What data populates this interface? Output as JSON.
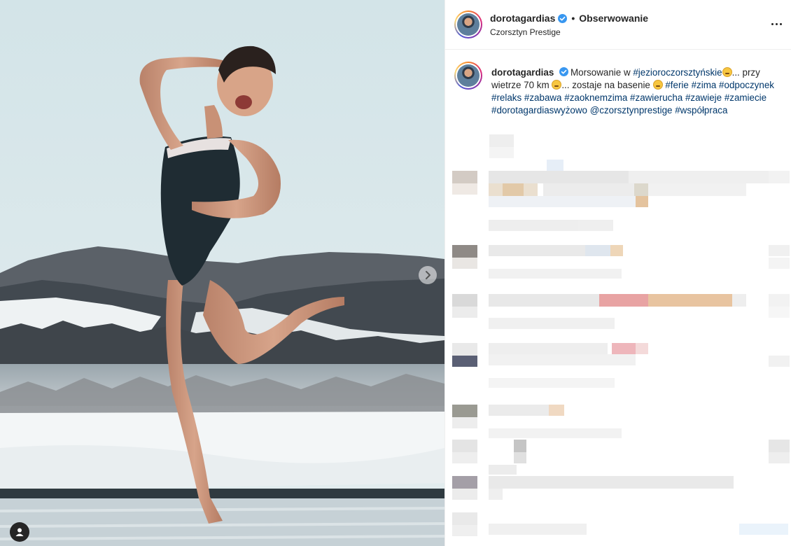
{
  "post": {
    "username": "dorotagardias",
    "follow_label": "Obserwowanie",
    "separator": "•",
    "location": "Czorsztyn Prestige"
  },
  "caption": {
    "username": "dorotagardias",
    "segments": [
      {
        "type": "text",
        "text": "Morsowanie w "
      },
      {
        "type": "tag",
        "text": "#jezioroczorsztyńskie"
      },
      {
        "type": "emoji",
        "name": "smirk-emoji"
      },
      {
        "type": "text",
        "text": "... przy wietrze 70 km "
      },
      {
        "type": "emoji",
        "name": "smirk-emoji"
      },
      {
        "type": "text",
        "text": "... zostaje na basenie "
      },
      {
        "type": "emoji",
        "name": "grimace-emoji"
      },
      {
        "type": "text",
        "text": " "
      },
      {
        "type": "tag",
        "text": "#ferie"
      },
      {
        "type": "text",
        "text": " "
      },
      {
        "type": "tag",
        "text": "#zima"
      },
      {
        "type": "text",
        "text": " "
      },
      {
        "type": "tag",
        "text": "#odpoczynek"
      },
      {
        "type": "text",
        "text": " "
      },
      {
        "type": "tag",
        "text": "#relaks"
      },
      {
        "type": "text",
        "text": " "
      },
      {
        "type": "tag",
        "text": "#zabawa"
      },
      {
        "type": "text",
        "text": " "
      },
      {
        "type": "tag",
        "text": "#zaoknemzima"
      },
      {
        "type": "text",
        "text": " "
      },
      {
        "type": "tag",
        "text": "#zawierucha"
      },
      {
        "type": "text",
        "text": " "
      },
      {
        "type": "tag",
        "text": "#zawieje"
      },
      {
        "type": "text",
        "text": " "
      },
      {
        "type": "tag",
        "text": "#zamiecie"
      },
      {
        "type": "text",
        "text": " "
      },
      {
        "type": "tag",
        "text": "#dorotagardiaswyżowo"
      },
      {
        "type": "text",
        "text": " "
      },
      {
        "type": "tag",
        "text": "@czorsztynprestige"
      },
      {
        "type": "text",
        "text": " "
      },
      {
        "type": "tag",
        "text": "#współpraca"
      }
    ]
  },
  "icons": {
    "verified": "verified-badge-icon",
    "more": "more-options-icon",
    "next": "chevron-right-icon",
    "tagged_user": "user-tag-icon"
  },
  "colors": {
    "link": "#00376b",
    "verified": "#3897f0",
    "text": "#262626"
  }
}
